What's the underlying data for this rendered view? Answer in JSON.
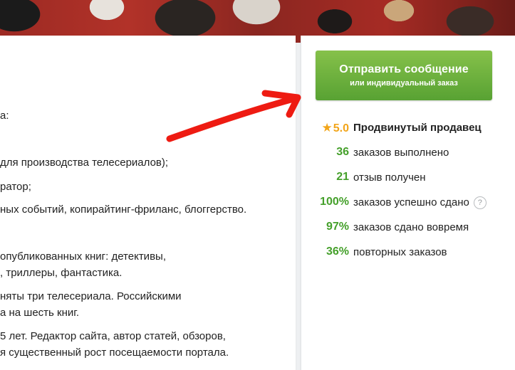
{
  "profile_text": [
    "а:",
    " для производства телесериалов);",
    "ратор;",
    "ных событий, копирайтинг-фриланс, блоггерство.",
    "опубликованных книг: детективы,",
    ", триллеры, фантастика.",
    "няты три телесериала. Российскими",
    "а на шесть книг.",
    "5 лет. Редактор сайта, автор статей, обзоров,",
    "я существенный рост посещаемости портала."
  ],
  "cta": {
    "label": "Отправить сообщение",
    "sublabel": "или индивидуальный заказ"
  },
  "rating": {
    "star_icon": "star-icon",
    "value": "5.0",
    "level": "Продвинутый продавец"
  },
  "stats": [
    {
      "value": "36",
      "label": "заказов выполнено"
    },
    {
      "value": "21",
      "label": "отзыв получен"
    },
    {
      "value": "100%",
      "label": "заказов успешно сдано",
      "help": "?"
    },
    {
      "value": "97%",
      "label": "заказов сдано вовремя"
    },
    {
      "value": "36%",
      "label": "повторных заказов"
    }
  ],
  "colors": {
    "accent_green": "#45a02b",
    "button_green": "#6cb33f",
    "star": "#f2a51a",
    "arrow": "#ee1b12"
  }
}
